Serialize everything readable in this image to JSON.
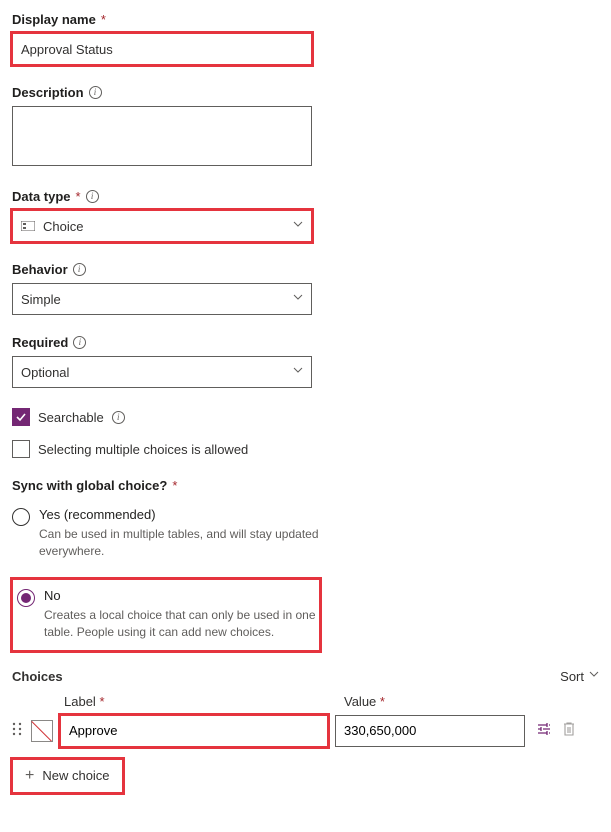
{
  "fields": {
    "displayName": {
      "label": "Display name",
      "value": "Approval Status"
    },
    "description": {
      "label": "Description",
      "value": ""
    },
    "dataType": {
      "label": "Data type",
      "value": "Choice"
    },
    "behavior": {
      "label": "Behavior",
      "value": "Simple"
    },
    "required": {
      "label": "Required",
      "value": "Optional"
    }
  },
  "checkboxes": {
    "searchable": {
      "label": "Searchable",
      "checked": true
    },
    "multiple": {
      "label": "Selecting multiple choices is allowed",
      "checked": false
    }
  },
  "sync": {
    "label": "Sync with global choice?",
    "yes": {
      "label": "Yes (recommended)",
      "desc": "Can be used in multiple tables, and will stay updated everywhere."
    },
    "no": {
      "label": "No",
      "desc": "Creates a local choice that can only be used in one table. People using it can add new choices."
    },
    "selected": "no"
  },
  "choices": {
    "title": "Choices",
    "sort_label": "Sort",
    "col_label": "Label",
    "col_value": "Value",
    "rows": [
      {
        "label": "Approve",
        "value": "330,650,000"
      }
    ],
    "new_choice_label": "New choice"
  }
}
